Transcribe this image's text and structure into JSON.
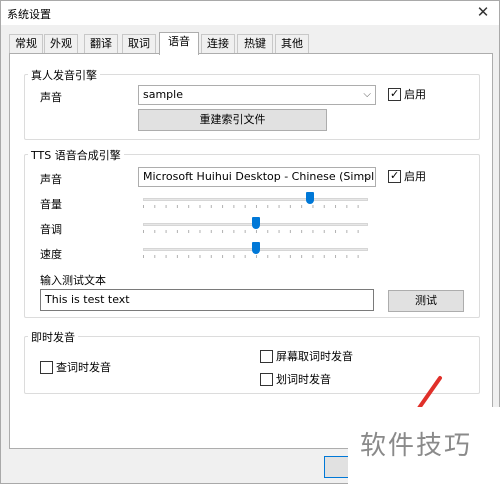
{
  "window": {
    "title": "系统设置",
    "close_glyph": "✕"
  },
  "tabs": [
    {
      "label": "常规"
    },
    {
      "label": "外观"
    },
    {
      "label": "翻译"
    },
    {
      "label": "取词"
    },
    {
      "label": "语音"
    },
    {
      "label": "连接"
    },
    {
      "label": "热键"
    },
    {
      "label": "其他"
    }
  ],
  "active_tab": "语音",
  "real_voice": {
    "title": "真人发音引擎",
    "voice_label": "声音",
    "voice_value": "sample",
    "enable_label": "启用",
    "enabled": true,
    "rebuild_button": "重建索引文件"
  },
  "tts": {
    "title": "TTS 语音合成引擎",
    "voice_label": "声音",
    "voice_value": "Microsoft Huihui Desktop - Chinese (Simplified)",
    "enable_label": "启用",
    "enabled": true,
    "volume_label": "音量",
    "volume_level": 0.75,
    "pitch_label": "音调",
    "pitch_level": 0.5,
    "speed_label": "速度",
    "speed_level": 0.5,
    "test_text_label": "输入测试文本",
    "test_text_value": "This is test text",
    "test_button": "测试"
  },
  "instant": {
    "title": "即时发音",
    "lookup_label": "查词时发音",
    "screen_label": "屏幕取词时发音",
    "select_label": "划词时发音"
  },
  "watermark": {
    "text": "软件技巧"
  },
  "colors": {
    "accent": "#0078d7",
    "arrow": "#e0302a"
  },
  "icons": {
    "dropdown": "chevron-down-icon",
    "check": "checkmark-icon"
  }
}
